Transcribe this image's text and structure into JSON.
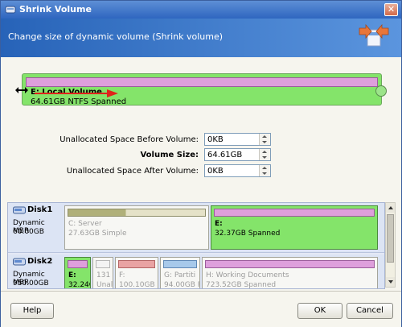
{
  "window": {
    "title": "Shrink Volume",
    "close_label": "✕"
  },
  "header": {
    "subtitle": "Change size of dynamic volume (Shrink volume)"
  },
  "volume": {
    "name": "E: Local Volume",
    "info": "64.61GB NTFS Spanned"
  },
  "fields": {
    "before_label": "Unallocated Space Before Volume:",
    "before_value": "0KB",
    "size_label": "Volume Size:",
    "size_value": "64.61GB",
    "after_label": "Unallocated Space After Volume:",
    "after_value": "0KB"
  },
  "disks": [
    {
      "name": "Disk1",
      "type": "Dynamic MBR",
      "size": "60.00GB",
      "partitions": [
        {
          "name": "C: Server",
          "info": "27.63GB Simple"
        },
        {
          "name": "E:",
          "info": "32.37GB Spanned"
        }
      ]
    },
    {
      "name": "Disk2",
      "type": "Dynamic MBR",
      "size": "950.00GB",
      "partitions": [
        {
          "name": "E:",
          "info": "32.24G"
        },
        {
          "name": "131",
          "info": "Unal"
        },
        {
          "name": "F:",
          "info": "100.10GB I"
        },
        {
          "name": "G: Partiti",
          "info": "94.00GB R"
        },
        {
          "name": "H: Working Documents",
          "info": "723.52GB Spanned"
        }
      ]
    }
  ],
  "buttons": {
    "help": "Help",
    "ok": "OK",
    "cancel": "Cancel"
  },
  "colors": {
    "selected_volume": "#84e46a",
    "spanned_bar": "#de9fdc",
    "simple_bar": "#b0b07a",
    "title_bar": "#2f66c0"
  }
}
